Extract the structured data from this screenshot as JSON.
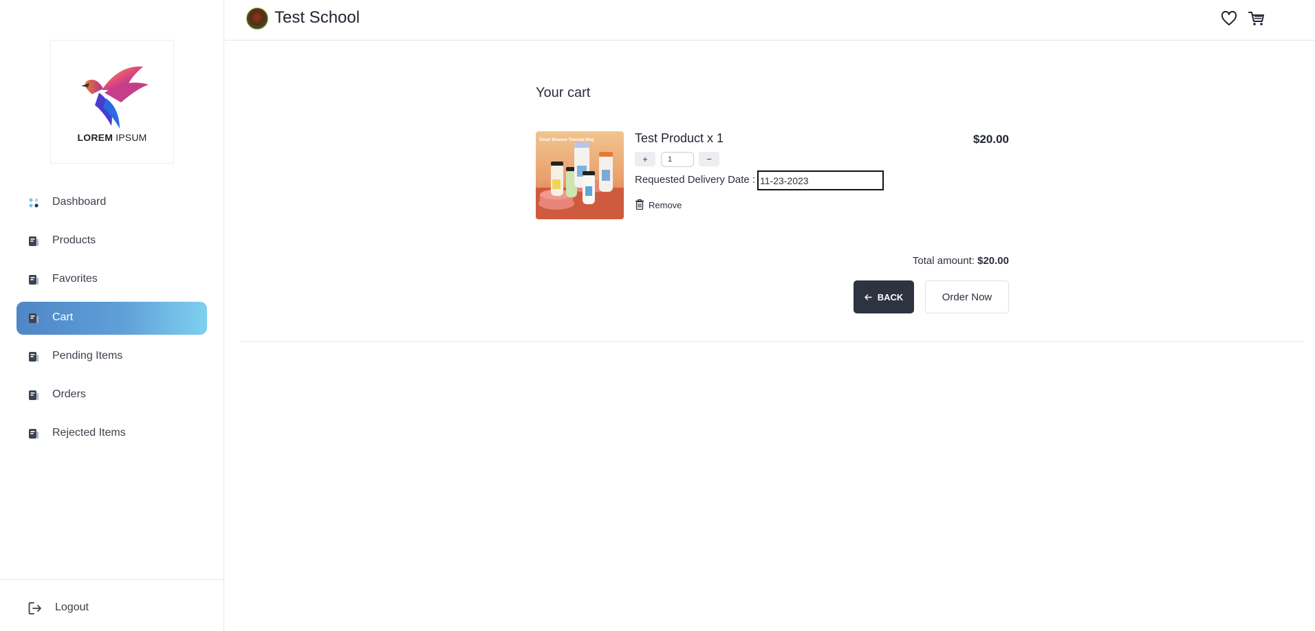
{
  "sidebar": {
    "logo": {
      "text_bold": "LOREM",
      "text_light": " IPSUM"
    },
    "items": [
      {
        "label": "Dashboard",
        "icon": "dashboard-icon",
        "active": false
      },
      {
        "label": "Products",
        "icon": "book-icon",
        "active": false
      },
      {
        "label": "Favorites",
        "icon": "book-icon",
        "active": false
      },
      {
        "label": "Cart",
        "icon": "book-icon",
        "active": true
      },
      {
        "label": "Pending Items",
        "icon": "book-icon",
        "active": false
      },
      {
        "label": "Orders",
        "icon": "book-icon",
        "active": false
      },
      {
        "label": "Rejected Items",
        "icon": "book-icon",
        "active": false
      }
    ],
    "logout_label": "Logout"
  },
  "header": {
    "school_name": "Test School",
    "icons": [
      "heart-icon",
      "cart-icon"
    ]
  },
  "cart": {
    "title": "Your cart",
    "item": {
      "name": "Test Product x 1",
      "price": "$20.00",
      "quantity": "1",
      "plus_label": "+",
      "minus_label": "−",
      "delivery_label": "Requested Delivery Date :",
      "delivery_date": "11-23-2023",
      "remove_label": "Remove",
      "image_caption": "Smart Bounce Thermal Mug"
    },
    "total_label": "Total amount:",
    "total_value": "$20.00",
    "back_label": "BACK",
    "order_label": "Order Now"
  },
  "colors": {
    "active_gradient_start": "#4f86c6",
    "active_gradient_end": "#7fd0ef",
    "back_button": "#2e3340"
  }
}
